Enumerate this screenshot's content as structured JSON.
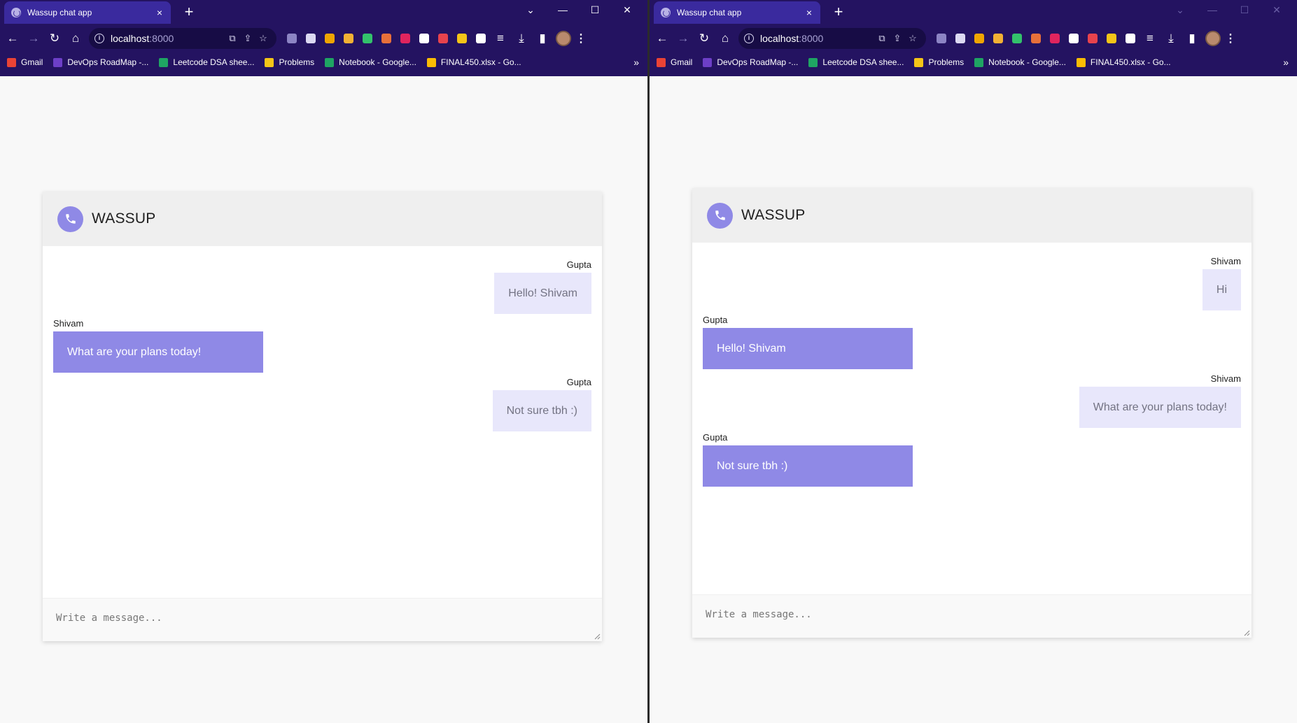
{
  "browser": {
    "tab_title": "Wassup chat app",
    "tab_close": "×",
    "new_tab": "+",
    "url_host": "localhost",
    "url_port": ":8000",
    "bookmarks_more": "»",
    "bookmarks": [
      {
        "label": "Gmail",
        "icon": "gmail-icon",
        "color": "#ea4335"
      },
      {
        "label": "DevOps RoadMap -...",
        "icon": "devops-roadmap-icon",
        "color": "#6d3fc7"
      },
      {
        "label": "Leetcode DSA shee...",
        "icon": "google-sheets-icon",
        "color": "#1fa463"
      },
      {
        "label": "Problems",
        "icon": "problems-icon",
        "color": "#f5c518"
      },
      {
        "label": "Notebook - Google...",
        "icon": "google-sheets-icon",
        "color": "#1fa463"
      },
      {
        "label": "FINAL450.xlsx - Go...",
        "icon": "google-drive-icon",
        "color": "#fbbc04"
      }
    ],
    "extensions": [
      {
        "icon": "chart-extension-icon",
        "color": "#8c84c4"
      },
      {
        "icon": "globe-extension-icon",
        "color": "#dcd9f2"
      },
      {
        "icon": "lh-extension-icon",
        "color": "#f0a500"
      },
      {
        "icon": "pen-extension-icon",
        "color": "#f2b134"
      },
      {
        "icon": "lock-extension-icon",
        "color": "#33c26b"
      },
      {
        "icon": "swirl-extension-icon",
        "color": "#e8703a"
      },
      {
        "icon": "play-extension-icon",
        "color": "#e0245e"
      },
      {
        "icon": "screen-extension-icon",
        "color": "#ffffff"
      },
      {
        "icon": "shield-extension-icon",
        "color": "#e8434d"
      },
      {
        "icon": "bulb-extension-icon",
        "color": "#f5c518"
      },
      {
        "icon": "puzzle-extensions-icon",
        "color": "#ffffff"
      }
    ]
  },
  "app": {
    "brand": "WASSUP",
    "placeholder": "Write a message...",
    "accent": "#8f89e6",
    "incoming_bubble": "#e8e7fb"
  },
  "left_window": {
    "messages": [
      {
        "sender": "Gupta",
        "text": "Hello! Shivam",
        "side": "out"
      },
      {
        "sender": "Shivam",
        "text": "What are your plans today!",
        "side": "in"
      },
      {
        "sender": "Gupta",
        "text": "Not sure tbh :)",
        "side": "out"
      }
    ]
  },
  "right_window": {
    "messages": [
      {
        "sender": "Shivam",
        "text": "Hi",
        "side": "out"
      },
      {
        "sender": "Gupta",
        "text": "Hello! Shivam",
        "side": "in"
      },
      {
        "sender": "Shivam",
        "text": "What are your plans today!",
        "side": "out"
      },
      {
        "sender": "Gupta",
        "text": "Not sure tbh :)",
        "side": "in"
      }
    ]
  }
}
